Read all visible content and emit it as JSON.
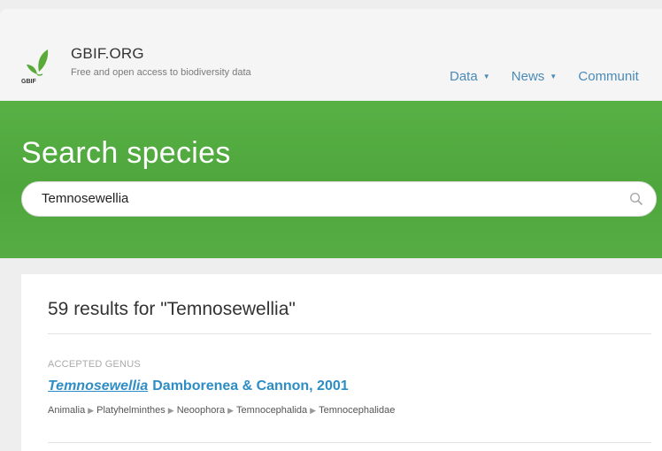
{
  "brand": {
    "title": "GBIF.ORG",
    "tagline": "Free and open access to biodiversity data",
    "logo_text": "GBIF"
  },
  "nav": [
    {
      "label": "Data",
      "has_dropdown": true
    },
    {
      "label": "News",
      "has_dropdown": true
    },
    {
      "label": "Communit",
      "has_dropdown": false
    }
  ],
  "hero": {
    "title": "Search species",
    "search_value": "Temnosewellia"
  },
  "results": {
    "count_text": "59 results for \"Temnosewellia\"",
    "items": [
      {
        "rank": "ACCEPTED GENUS",
        "name": "Temnosewellia",
        "authorship": "Damborenea & Cannon, 2001",
        "classification": [
          "Animalia",
          "Platyhelminthes",
          "Neoophora",
          "Temnocephalida",
          "Temnocephalidae"
        ]
      }
    ]
  },
  "colors": {
    "brand_green": "#56ad43",
    "link_blue": "#2d8dc4",
    "nav_blue": "#4a8ab8"
  },
  "icons": {
    "logo": "gbif-leaf-logo",
    "search": "search-icon",
    "dropdown": "caret-down-icon",
    "separator": "chevron-right-icon"
  }
}
